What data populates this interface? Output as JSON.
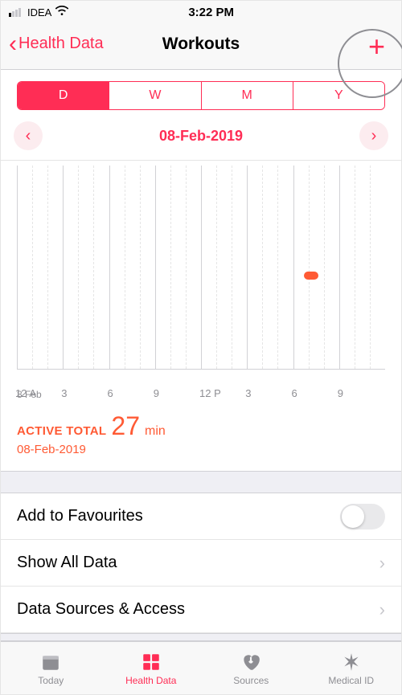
{
  "status": {
    "carrier": "IDEA",
    "time": "3:22 PM"
  },
  "nav": {
    "back_label": "Health Data",
    "title": "Workouts",
    "add_glyph": "+"
  },
  "seg": {
    "d": "D",
    "w": "W",
    "m": "M",
    "y": "Y",
    "active": "D"
  },
  "date_nav": {
    "label": "08-Feb-2019"
  },
  "chart_data": {
    "type": "bar",
    "title": "Workouts",
    "xlabel": "",
    "ylabel": "",
    "categories": [
      "12 A",
      "3",
      "6",
      "9",
      "12 P",
      "3",
      "6",
      "9"
    ],
    "values": [
      0,
      0,
      0,
      0,
      0,
      0,
      27,
      0
    ],
    "date_sub": "8 Feb"
  },
  "chart_x": {
    "h0": "12 A",
    "h3": "3",
    "h6": "6",
    "h9": "9",
    "h12": "12 P",
    "h15": "3",
    "h18": "6",
    "h21": "9",
    "sub": "8 Feb"
  },
  "summary": {
    "label": "ACTIVE TOTAL",
    "value": "27",
    "unit": "min",
    "date": "08-Feb-2019"
  },
  "cells": {
    "favourites": "Add to Favourites",
    "show_all": "Show All Data",
    "sources": "Data Sources & Access"
  },
  "tabs": {
    "today": "Today",
    "health": "Health Data",
    "sources": "Sources",
    "medical": "Medical ID"
  }
}
